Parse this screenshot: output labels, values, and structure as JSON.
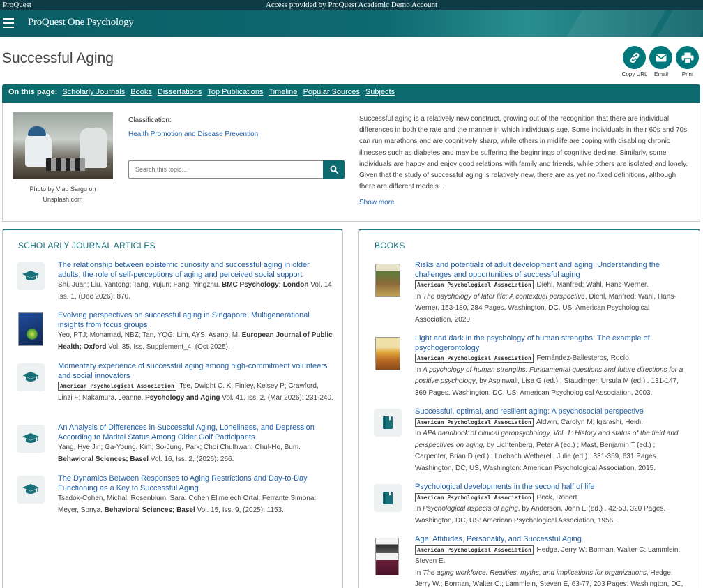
{
  "topbar": {
    "brand": "ProQuest",
    "access": "Access provided by ProQuest Academic Demo Account"
  },
  "navbar": {
    "product": "ProQuest One Psychology"
  },
  "page": {
    "title": "Successful Aging"
  },
  "actions": [
    {
      "label": "Copy URL",
      "icon": "link-icon"
    },
    {
      "label": "Email",
      "icon": "email-icon"
    },
    {
      "label": "Print",
      "icon": "print-icon"
    }
  ],
  "onpage": {
    "lead": "On this page:",
    "links": [
      "Scholarly Journals",
      "Books",
      "Dissertations",
      "Top Publications",
      "Timeline",
      "Popular Sources",
      "Subjects"
    ]
  },
  "topic": {
    "photo_credit": "Photo by Vlad Sargu on Unsplash.com",
    "classification_label": "Classification:",
    "classification_value": "Health Promotion and Disease Prevention",
    "search_placeholder": "Search this topic...",
    "description": "Successful aging is a relatively new construct, growing out of the recognition that there are individual differences in both the rate and the manner in which individuals age. Some individuals in their 60s and 70s can run marathons and are cognitively sharp, while others in midlife are coping with disabling chronic illnesses such as diabetes and may be suffering the beginnings of cognitive decline. Similarly, some individuals are happy and enjoy good relations with family and friends, while others are isolated and lonely. Given that the study of successful aging is relatively new, there are as yet no fixed definitions, although there are different models...",
    "show_more": "Show more"
  },
  "journals": {
    "heading": "SCHOLARLY JOURNAL ARTICLES",
    "items": [
      {
        "title": "The relationship between epistemic curiosity and successful aging in older adults: the role of self-perceptions of aging and perceived social support",
        "authors": "Shi, Juan; Liu, Yantong; Tang, Yujun; Fang, Yingzhu.",
        "source": "BMC Psychology; London",
        "details": "Vol. 14, Iss. 1,  (Dec 2026): 870."
      },
      {
        "title": "Evolving perspectives on successful aging in Singapore: Multigenerational insights from focus groups",
        "authors": "Yeo, PTJ; Mohamad, NBZ; Tan, YQG; Lim, AYS; Asano, M.",
        "source": "European Journal of Public Health; Oxford",
        "details": "Vol. 35, Iss. Supplement_4,  (Oct 2025)."
      },
      {
        "title": "Momentary experience of successful aging among high-commitment volunteers and social innovators",
        "publisher": "American Psychological Association",
        "authors": "Tse, Dwight C. K; Finley, Kelsey P; Crawford, Linzi F; Nakamura, Jeanne.",
        "source": "Psychology and Aging",
        "details": "Vol. 41, Iss. 2,  (Mar 2026): 231-240."
      },
      {
        "title": "An Analysis of Differences in Successful Aging, Loneliness, and Depression According to Marital Status Among Older Golf Participants",
        "authors": "Yang, Hye Jin; Ga-Young, Kim; So-Jung, Park; Choi Chulhwan; Chul-Ho, Bum.",
        "source": "Behavioral Sciences; Basel",
        "details": "Vol. 16, Iss. 2,  (2026): 266."
      },
      {
        "title": "The Dynamics Between Responses to Aging Restrictions and Day-to-Day Functioning as a Key to Successful Aging",
        "authors": "Tsadok-Cohen, Michal; Rosenblum, Sara; Cohen Elimelech Ortal; Ferrante Simona; Meyer, Sonya.",
        "source": "Behavioral Sciences; Basel",
        "details": "Vol. 15, Iss. 9,  (2025): 1153."
      }
    ]
  },
  "books": {
    "heading": "BOOKS",
    "items": [
      {
        "title": "Risks and potentials of adult development and aging: Understanding the challenges and opportunities of successful aging",
        "publisher": "American Psychological Association",
        "authors": "Diehl, Manfred; Wahl, Hans-Werner.",
        "in_prefix": "In",
        "in_title": "The psychology of later life: A contextual perspective",
        "in_rest": ", Diehl, Manfred; Wahl, Hans-Werner,  153-180, 284 Pages. Washington, DC, US: American Psychological Association, 2020."
      },
      {
        "title": "Light and dark in the psychology of human strengths: The example of psychogerontology",
        "publisher": "American Psychological Association",
        "authors": "Fernández-Ballesteros, Rocío.",
        "in_prefix": "In",
        "in_title": "A psychology of human strengths: Fundamental questions and future directions for a positive psychology",
        "in_rest": ", by Aspinwall, Lisa G (ed.) ; Staudinger, Ursula M (ed.) .  131-147, 369 Pages. Washington, DC, US: American Psychological Association, 2003."
      },
      {
        "title": "Successful, optimal, and resilient aging: A psychosocial perspective",
        "publisher": "American Psychological Association",
        "authors": "Aldwin, Carolyn M; Igarashi, Heidi.",
        "in_prefix": "In",
        "in_title": "APA handbook of clinical geropsychology, Vol. 1: History and status of the field and perspectives on aging",
        "in_rest": ", by Lichtenberg, Peter A (ed.) ; Mast, Benjamin T (ed.) ; Carpenter, Brian D (ed.) ; Loebach Wetherell, Julie (ed.) .  331-359, 631 Pages. Washington, DC, US, Washington: American Psychological Association, 2015."
      },
      {
        "title": "Psychological developments in the second half of life",
        "publisher": "American Psychological Association",
        "authors": "Peck, Robert.",
        "in_prefix": "In",
        "in_title": "Psychological aspects of aging",
        "in_rest": ", by Anderson, John E (ed.) .  42-53, 320 Pages. Washington, DC, US: American Psychological Association, 1956."
      },
      {
        "title": "Age, Attitudes, Personality, and Successful Aging",
        "publisher": "American Psychological Association",
        "authors": "Hedge, Jerry W; Borman, Walter C; Lammlein, Steven E.",
        "in_prefix": "In",
        "in_title": "The aging workforce: Realities, myths, and implications for organizations",
        "in_rest": ", Hedge, Jerry W.; Borman, Walter C.; Lammlein, Steven E,  63-77, 203 Pages. Washington, DC,"
      }
    ]
  },
  "colors": {
    "teal": "#0d6a6f",
    "link": "#1f5fa8",
    "topbar": "#0f3b46"
  }
}
